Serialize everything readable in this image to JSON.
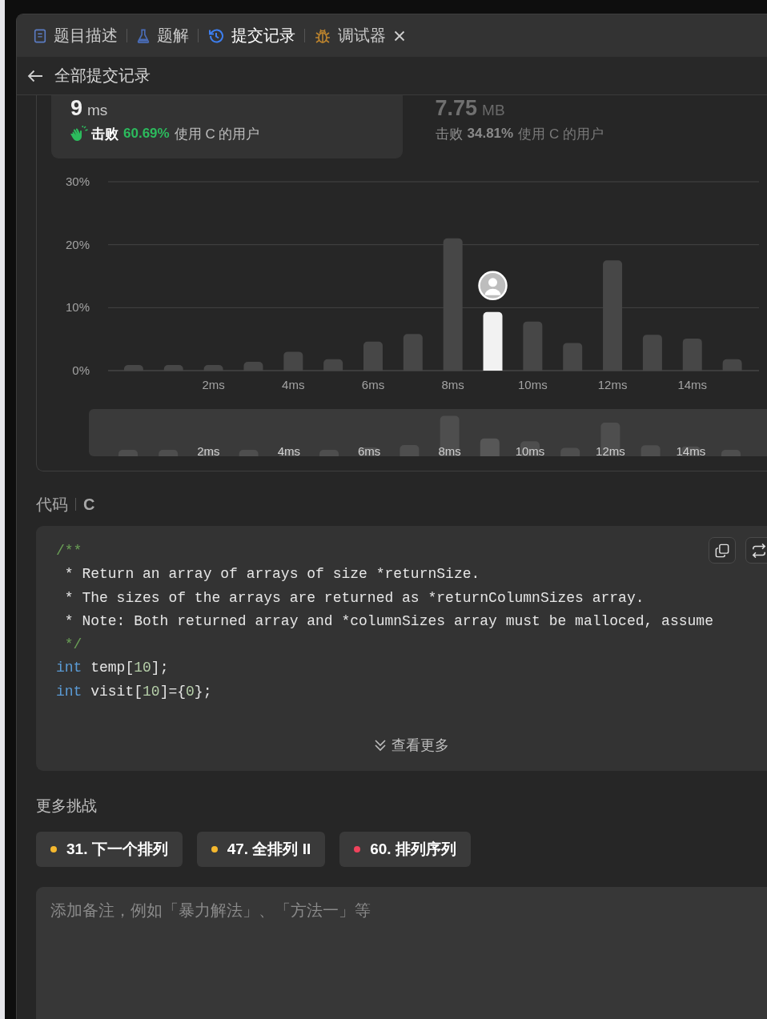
{
  "tabs": [
    {
      "label": "题目描述",
      "kind": "document",
      "selected": false,
      "closable": false
    },
    {
      "label": "题解",
      "kind": "flask",
      "selected": false,
      "closable": false
    },
    {
      "label": "提交记录",
      "kind": "history",
      "selected": true,
      "closable": false
    },
    {
      "label": "调试器",
      "kind": "bug",
      "selected": false,
      "closable": true
    }
  ],
  "header": {
    "title": "全部提交记录"
  },
  "stats": [
    {
      "value": "9",
      "unit": "ms",
      "beat_label": "击败",
      "percent": "60.69%",
      "suffix": "使用 C 的用户",
      "selected": true
    },
    {
      "value": "7.75",
      "unit": "MB",
      "beat_label": "击败",
      "percent": "34.81%",
      "suffix": "使用 C 的用户",
      "selected": false
    }
  ],
  "distribution": {
    "chart_data": {
      "type": "bar",
      "x": [
        0,
        1,
        2,
        3,
        4,
        5,
        6,
        7,
        8,
        9,
        10,
        11,
        12,
        13,
        14,
        15
      ],
      "series": [
        {
          "color": "#474747",
          "values": [
            0.9,
            0.9,
            0.9,
            1.4,
            3.0,
            1.8,
            4.6,
            5.8,
            21.0,
            null,
            7.8,
            4.4,
            17.5,
            5.7,
            5.1,
            1.8
          ]
        },
        {
          "color": "#f2f2f2",
          "values": [
            null,
            null,
            null,
            null,
            null,
            null,
            null,
            null,
            null,
            9.3,
            null,
            null,
            null,
            null,
            null,
            null
          ]
        }
      ],
      "ylim": [
        0,
        30
      ],
      "yticks": [
        {
          "value": 0,
          "label": "0%"
        },
        {
          "value": 10,
          "label": "10%"
        },
        {
          "value": 20,
          "label": "20%"
        },
        {
          "value": 30,
          "label": "30%"
        }
      ],
      "xticks": [
        {
          "value": 2,
          "label": "2ms"
        },
        {
          "value": 4,
          "label": "4ms"
        },
        {
          "value": 6,
          "label": "6ms"
        },
        {
          "value": 8,
          "label": "8ms"
        },
        {
          "value": 10,
          "label": "10ms"
        },
        {
          "value": 12,
          "label": "12ms"
        },
        {
          "value": 14,
          "label": "14ms"
        }
      ],
      "xlim": [
        -0.64,
        15.67
      ]
    },
    "navigator": {
      "labels": [
        "2ms",
        "4ms",
        "6ms",
        "8ms",
        "10ms",
        "12ms",
        "14ms"
      ]
    }
  },
  "code": {
    "label": "代码",
    "language": "C",
    "show_more": "查看更多",
    "lines": [
      [
        {
          "text": "/**",
          "kind": "comment"
        }
      ],
      [
        {
          "text": " * Return an array of arrays of size *returnSize.",
          "kind": "plain"
        }
      ],
      [
        {
          "text": " * The sizes of the arrays are returned as *returnColumnSizes array.",
          "kind": "plain"
        }
      ],
      [
        {
          "text": " * Note: Both returned array and *columnSizes array must be malloced, assume",
          "kind": "plain"
        }
      ],
      [
        {
          "text": " */",
          "kind": "comment"
        }
      ],
      [
        {
          "text": "int",
          "kind": "keyword"
        },
        {
          "text": " temp[",
          "kind": "plain"
        },
        {
          "text": "10",
          "kind": "number"
        },
        {
          "text": "];",
          "kind": "plain"
        }
      ],
      [
        {
          "text": "int",
          "kind": "keyword"
        },
        {
          "text": " visit[",
          "kind": "plain"
        },
        {
          "text": "10",
          "kind": "number"
        },
        {
          "text": "]={",
          "kind": "plain"
        },
        {
          "text": "0",
          "kind": "number"
        },
        {
          "text": "};",
          "kind": "plain"
        }
      ]
    ]
  },
  "more_challenges": {
    "title": "更多挑战",
    "items": [
      {
        "label": "31. 下一个排列",
        "color": "#f5b82e"
      },
      {
        "label": "47. 全排列 II",
        "color": "#f5b82e"
      },
      {
        "label": "60. 排列序列",
        "color": "#f0435c"
      }
    ]
  },
  "note": {
    "placeholder": "添加备注，例如「暴力解法」、「方法一」等"
  }
}
